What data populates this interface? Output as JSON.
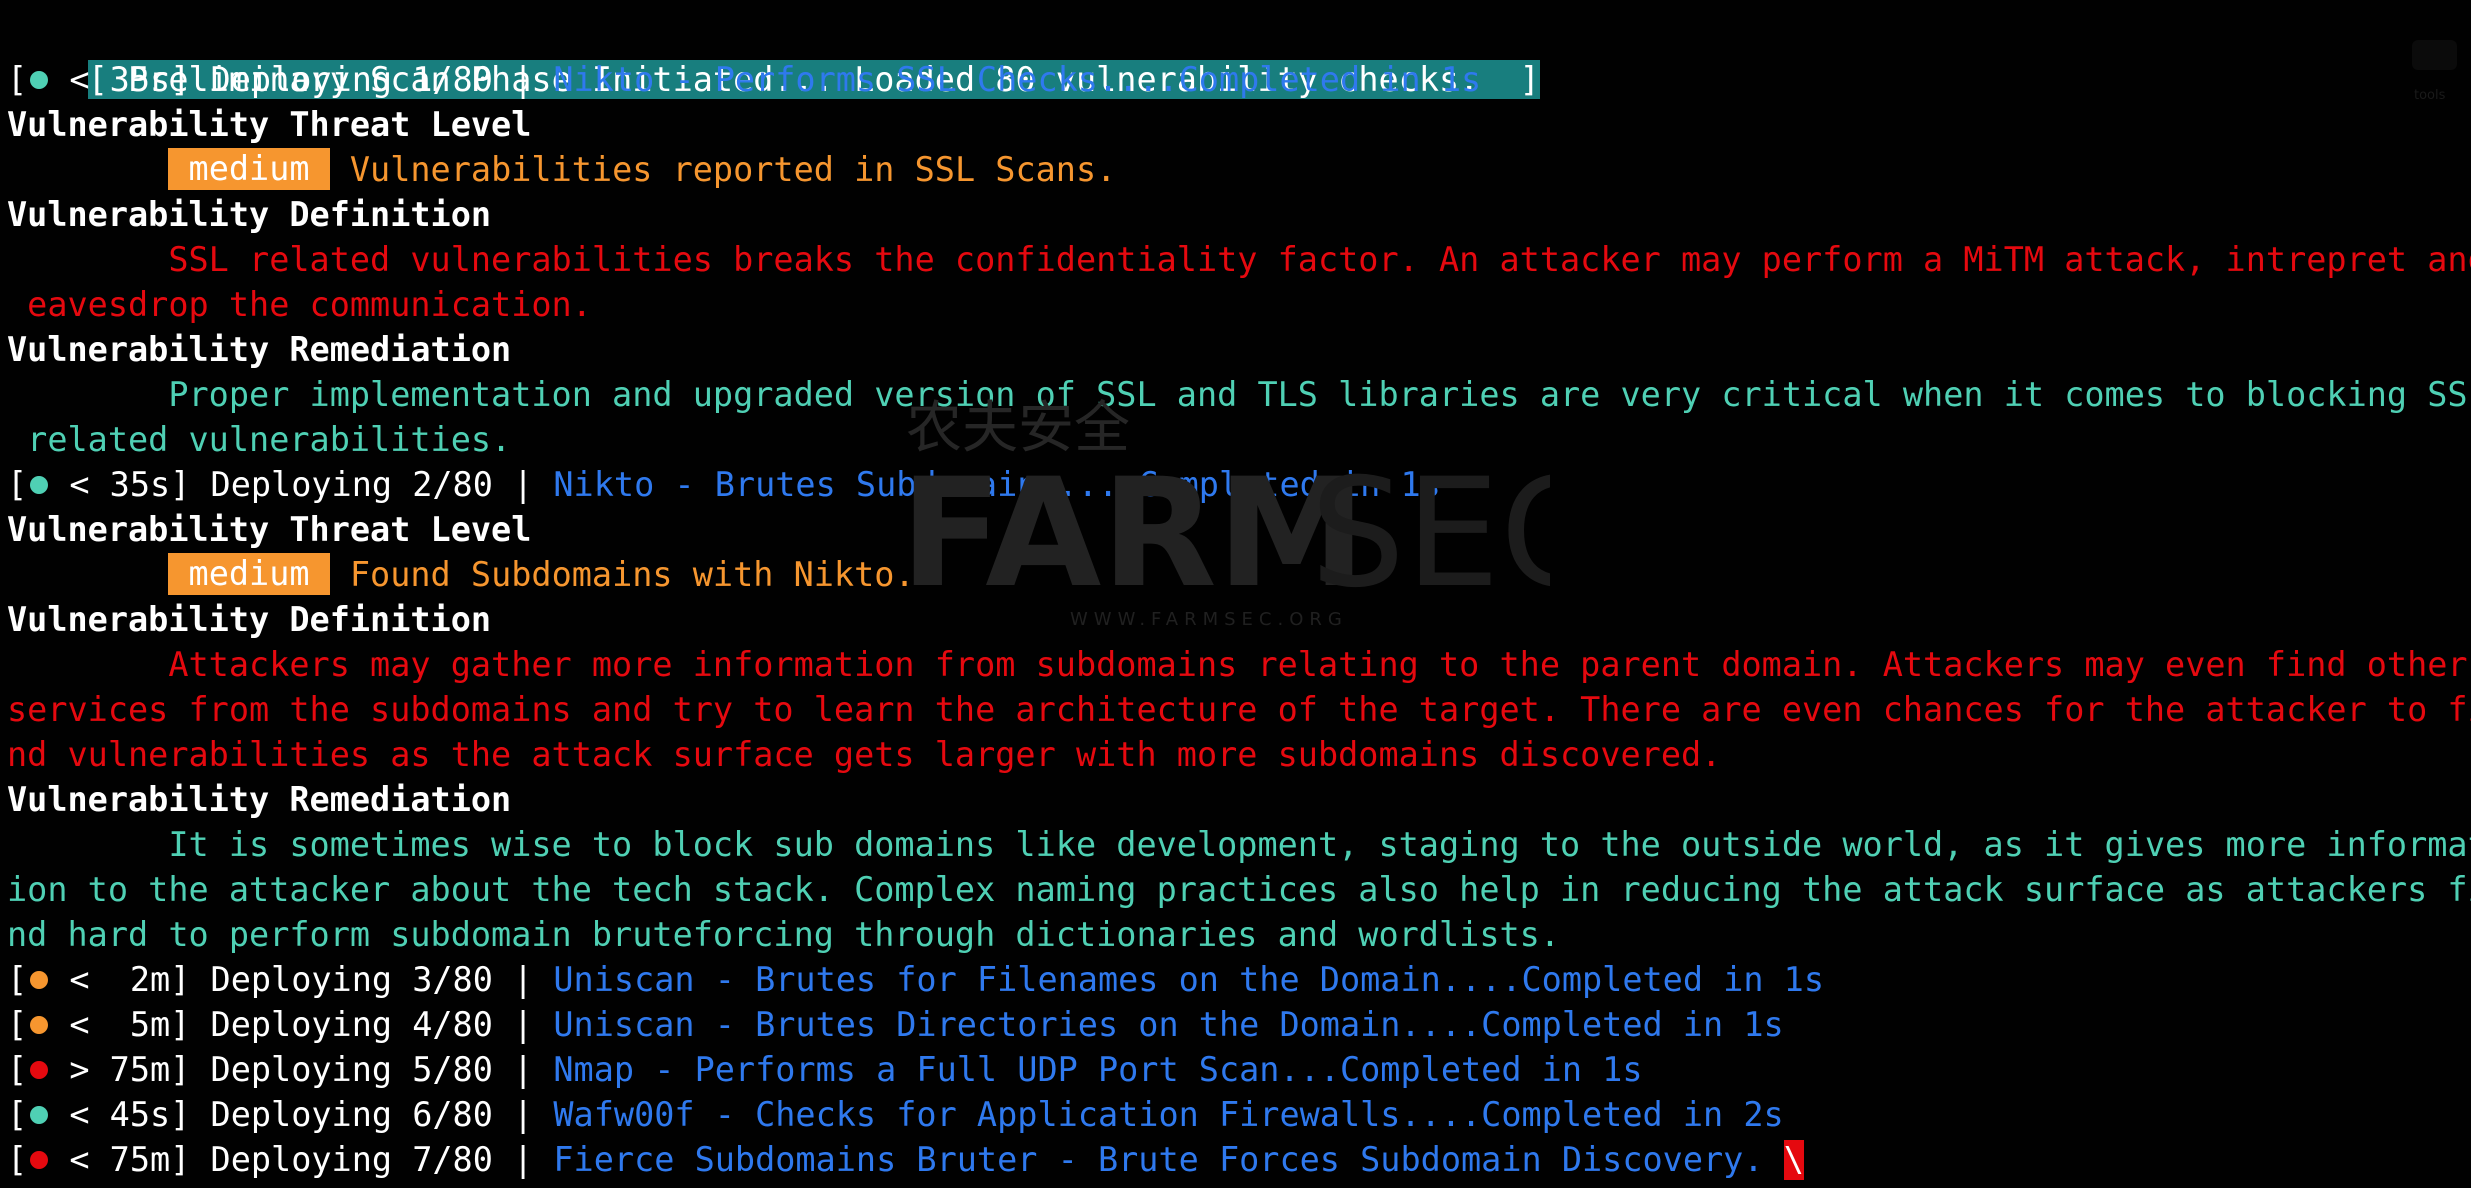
{
  "terminal": {
    "banner": "[ Preliminary Scan Phase Initiated... Loaded 80 vulnerability checks.  ]",
    "headings": {
      "threat_level": "Vulnerability Threat Level",
      "definition": "Vulnerability Definition",
      "remediation": "Vulnerability Remediation"
    },
    "checks": [
      {
        "status_color": "#4fd0b4",
        "time_label": " < 35s] Deploying 1/80 | ",
        "task": "Nikto - Performs SSL Checks....Completed in 1s",
        "severity": "medium",
        "threat_text": " Vulnerabilities reported in SSL Scans.",
        "definition_lines": [
          "        SSL related vulnerabilities breaks the confidentiality factor. An attacker may perform a MiTM attack, intrepret and",
          " eavesdrop the communication."
        ],
        "remediation_lines": [
          "        Proper implementation and upgraded version of SSL and TLS libraries are very critical when it comes to blocking SSL",
          " related vulnerabilities."
        ]
      },
      {
        "status_color": "#4fd0b4",
        "time_label": " < 35s] Deploying 2/80 | ",
        "task": "Nikto - Brutes Subdomains....Completed in 1s",
        "severity": "medium",
        "threat_text": " Found Subdomains with Nikto.",
        "definition_lines": [
          "        Attackers may gather more information from subdomains relating to the parent domain. Attackers may even find other",
          "services from the subdomains and try to learn the architecture of the target. There are even chances for the attacker to fi",
          "nd vulnerabilities as the attack surface gets larger with more subdomains discovered."
        ],
        "remediation_lines": [
          "        It is sometimes wise to block sub domains like development, staging to the outside world, as it gives more informat",
          "ion to the attacker about the tech stack. Complex naming practices also help in reducing the attack surface as attackers fi",
          "nd hard to perform subdomain bruteforcing through dictionaries and wordlists."
        ]
      }
    ],
    "deploy_lines": [
      {
        "status_color": "#f6962f",
        "time_label": " <  2m] Deploying 3/80 | ",
        "task": "Uniscan - Brutes for Filenames on the Domain....Completed in 1s"
      },
      {
        "status_color": "#f6962f",
        "time_label": " <  5m] Deploying 4/80 | ",
        "task": "Uniscan - Brutes Directories on the Domain....Completed in 1s"
      },
      {
        "status_color": "#e5090f",
        "time_label": " > 75m] Deploying 5/80 | ",
        "task": "Nmap - Performs a Full UDP Port Scan...Completed in 1s"
      },
      {
        "status_color": "#4fd0b4",
        "time_label": " < 45s] Deploying 6/80 | ",
        "task": "Wafw00f - Checks for Application Firewalls....Completed in 2s"
      },
      {
        "status_color": "#e5090f",
        "time_label": " < 75m] Deploying 7/80 | ",
        "task": "Fierce Subdomains Bruter - Brute Forces Subdomain Discovery. "
      }
    ],
    "bracket_open": "[",
    "cursor_glyph": "\\"
  },
  "watermark": {
    "cn_text": "农夫安全",
    "logo_bold": "FARM",
    "logo_light": "SEC",
    "site": "WWW.FARMSEC.ORG"
  },
  "side_panel": {
    "label": "tools"
  },
  "colors": {
    "background": "#010101",
    "banner": "#187e7e",
    "task_blue": "#2f79ee",
    "medium_orange": "#f6962f",
    "definition_red": "#e5090f",
    "remediation_teal": "#4fd0b4"
  }
}
